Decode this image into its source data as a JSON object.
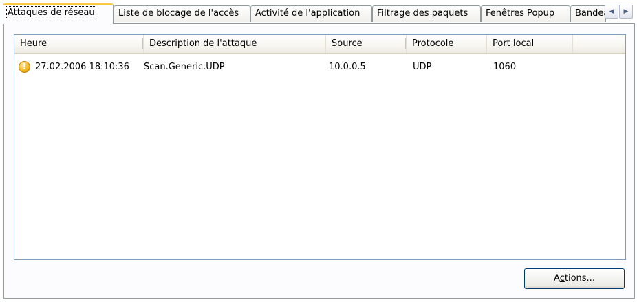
{
  "tabs": [
    {
      "label": "Attaques de réseau",
      "active": true
    },
    {
      "label": "Liste de blocage de l'accès",
      "active": false
    },
    {
      "label": "Activité de l'application",
      "active": false
    },
    {
      "label": "Filtrage des paquets",
      "active": false
    },
    {
      "label": "Fenêtres Popup",
      "active": false
    },
    {
      "label": "Bandeaux",
      "active": false
    }
  ],
  "tab_scroll": {
    "left_icon": "chevron-left-icon",
    "right_icon": "chevron-right-icon"
  },
  "table": {
    "columns": [
      "Heure",
      "Description de l'attaque",
      "Source",
      "Protocole",
      "Port local"
    ],
    "rows": [
      {
        "icon": "warning-icon",
        "icon_glyph": "!",
        "cells": [
          "27.02.2006 18:10:36",
          "Scan.Generic.UDP",
          "10.0.0.5",
          "UDP",
          "1060"
        ]
      }
    ]
  },
  "actions_button": {
    "label_pre": "A",
    "label_mnemonic": "c",
    "label_post": "tions..."
  },
  "colors": {
    "active_tab_accent": "#ffc83c",
    "warning_icon": "#f5b41e",
    "list_border": "#7f9db9",
    "button_border": "#003c74"
  }
}
